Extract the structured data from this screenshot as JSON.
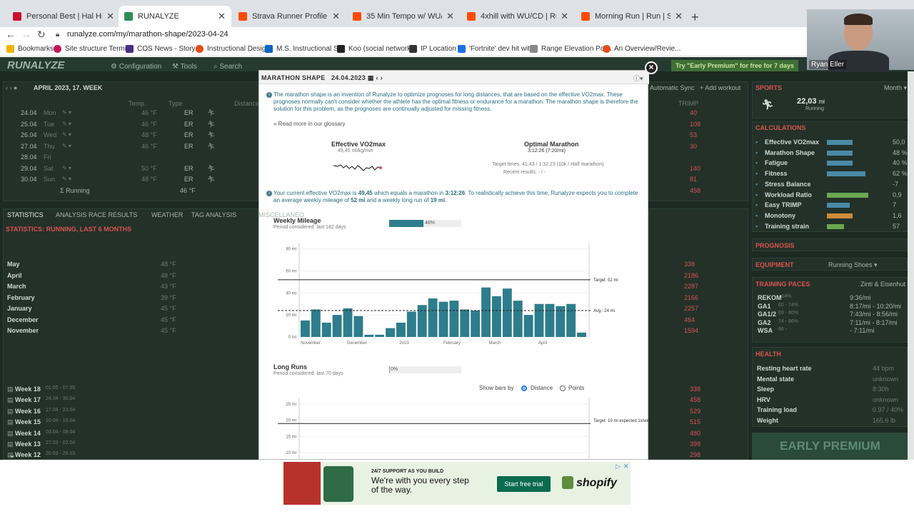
{
  "tabs": [
    {
      "title": "Personal Best | Hal Higdon",
      "color": "#c8102e"
    },
    {
      "title": "RUNALYZE",
      "color": "#2e8b57"
    },
    {
      "title": "Strava Runner Profile | Ryan Eller",
      "color": "#fc4c02"
    },
    {
      "title": "35 Min Tempo w/ WU/CD | Run |",
      "color": "#fc4c02"
    },
    {
      "title": "4xhill with WU/CD | Run | Strava",
      "color": "#fc4c02"
    },
    {
      "title": "Morning Run | Run | Strava",
      "color": "#fc4c02"
    }
  ],
  "url": "runalyze.com/my/marathon-shape/2023-04-24",
  "bookmarks": [
    {
      "label": "Bookmarks",
      "color": "#f2b400"
    },
    {
      "label": "Site structure Termi...",
      "color": "#c2185b"
    },
    {
      "label": "COS News - Story/...",
      "color": "#4b2e83"
    },
    {
      "label": "Instructional Design",
      "color": "#e64a19"
    },
    {
      "label": "M.S. Instructional S...",
      "color": "#0a66c2"
    },
    {
      "label": "Koo (social network...",
      "color": "#222222"
    },
    {
      "label": "IP Location",
      "color": "#333333"
    },
    {
      "label": "'Fortnite' dev hit wit...",
      "color": "#1a73e8"
    },
    {
      "label": "Range Elevation Pol...",
      "color": "#888888"
    },
    {
      "label": "An Overview/Revie...",
      "color": "#e64a19"
    }
  ],
  "webcam_name": "Ryan Eller",
  "app": {
    "logo": "RUNALYZE",
    "nav": [
      "Configuration",
      "Tools",
      "Search"
    ],
    "premium": "Try \"Early Premium\" for free for 7 days",
    "week_title": "APRIL 2023, 17. WEEK",
    "days": [
      {
        "date": "24.04",
        "day": "Mon",
        "temp": "46 °F",
        "type": "ER"
      },
      {
        "date": "25.04",
        "day": "Tue",
        "temp": "46 °F",
        "type": "ER"
      },
      {
        "date": "26.04",
        "day": "Wed",
        "temp": "48 °F",
        "type": "ER"
      },
      {
        "date": "27.04",
        "day": "Thu",
        "temp": "46 °F",
        "type": "ER"
      },
      {
        "date": "28.04",
        "day": "Fri",
        "temp": "",
        "type": ""
      },
      {
        "date": "29.04",
        "day": "Sat",
        "temp": "50 °F",
        "type": "ER"
      },
      {
        "date": "30.04",
        "day": "Sun",
        "temp": "48 °F",
        "type": "ER"
      }
    ],
    "trimp": [
      "40",
      "108",
      "53",
      "30",
      "",
      "140",
      "81"
    ],
    "sum_label": "Running",
    "sum_temp": "46 °F",
    "sum_trimp": "458",
    "stats_tabs": [
      "STATISTICS",
      "ANALYSIS",
      "RACE RESULTS",
      "WEATHER",
      "TAG ANALYSIS",
      "MISCELLANEO"
    ],
    "stats_title": "STATISTICS: RUNNING, LAST 6 MONTHS",
    "months": [
      {
        "name": "May",
        "temp": "48 °F",
        "trimp": "338"
      },
      {
        "name": "April",
        "temp": "48 °F",
        "trimp": "2186"
      },
      {
        "name": "March",
        "temp": "43 °F",
        "trimp": "2287"
      },
      {
        "name": "February",
        "temp": "39 °F",
        "trimp": "2166"
      },
      {
        "name": "January",
        "temp": "45 °F",
        "trimp": "2257"
      },
      {
        "name": "December",
        "temp": "45 °F",
        "trimp": "464"
      },
      {
        "name": "November",
        "temp": "45 °F",
        "trimp": "1594"
      }
    ],
    "weeks": [
      {
        "name": "Week 18",
        "range": "01.05 - 07.05",
        "trimp": "338"
      },
      {
        "name": "Week 17",
        "range": "24.04 - 30.04",
        "trimp": "458"
      },
      {
        "name": "Week 16",
        "range": "17.04 - 23.04",
        "trimp": "529"
      },
      {
        "name": "Week 15",
        "range": "10.04 - 16.04",
        "trimp": "515"
      },
      {
        "name": "Week 14",
        "range": "03.04 - 09.04",
        "trimp": "480"
      },
      {
        "name": "Week 13",
        "range": "27.03 - 02.04",
        "trimp": "398"
      },
      {
        "name": "Week 12",
        "range": "20.03 - 26.03",
        "trimp": "298"
      }
    ],
    "right_ctrl": [
      "Automatic Sync",
      "Add workout",
      "Month"
    ],
    "sports_title": "SPORTS",
    "sports_value": "22,03",
    "sports_unit": "mi",
    "sports_label": "Running",
    "calc_title": "CALCULATIONS",
    "calcs": [
      {
        "label": "Effective VO2max",
        "value": "50,0",
        "bar": 0.45,
        "color": "#4a8aa8"
      },
      {
        "label": "Marathon Shape",
        "value": "48 %",
        "bar": 0.45,
        "color": "#4a8aa8"
      },
      {
        "label": "Fatigue",
        "value": "40 %",
        "bar": 0.45,
        "color": "#4a8aa8"
      },
      {
        "label": "Fitness",
        "value": "62 %",
        "bar": 0.68,
        "color": "#4a8aa8"
      },
      {
        "label": "Stress Balance",
        "value": "-7",
        "bar": 0.0,
        "color": "#4a8aa8"
      },
      {
        "label": "Workload Ratio",
        "value": "0,9",
        "bar": 0.72,
        "color": "#6aa84f"
      },
      {
        "label": "Easy TRIMP",
        "value": "7",
        "bar": 0.4,
        "color": "#4a8aa8"
      },
      {
        "label": "Monotony",
        "value": "1,6",
        "bar": 0.45,
        "color": "#d08a3a"
      },
      {
        "label": "Training strain",
        "value": "57",
        "bar": 0.3,
        "color": "#6aa84f"
      }
    ],
    "prognosis_title": "PROGNOSIS",
    "equipment_title": "EQUIPMENT",
    "equipment_sel": "Running Shoes",
    "paces_title": "TRAINING PACES",
    "paces_sel": "Zinti & Eisenhut",
    "paces": [
      {
        "label": "REKOM",
        "range": "- 64%",
        "value": "9:36/mi"
      },
      {
        "label": "GA1",
        "range": "60 - 74%",
        "value": "8:17/mi - 10:20/mi"
      },
      {
        "label": "GA1/2",
        "range": "69 - 80%",
        "value": "7:43/mi - 8:56/mi"
      },
      {
        "label": "GA2",
        "range": "74 - 86%",
        "value": "7:11/mi - 8:17/mi"
      },
      {
        "label": "WSA",
        "range": "86 -",
        "value": "- 7:11/mi"
      }
    ],
    "health_title": "HEALTH",
    "health": [
      {
        "label": "Resting heart rate",
        "value": "44 bpm"
      },
      {
        "label": "Mental state",
        "value": "unknown"
      },
      {
        "label": "Sleep",
        "value": "8:30h"
      },
      {
        "label": "HRV",
        "value": "unknown"
      },
      {
        "label": "Training load",
        "value": "0.97 / 40%"
      },
      {
        "label": "Weight",
        "value": "165.6 lb"
      }
    ],
    "early_premium": "EARLY PREMIUM"
  },
  "modal": {
    "title": "MARATHON SHAPE",
    "date": "24.04.2023",
    "intro": "The marathon shape is an invention of Runalyze to optimize prognoses for long distances, that are based on the effective VO2max. These prognoses normally can't consider whether the athlete has the optimal fitness or endurance for a marathon. The marathon shape is therefore the solution for this problem, as the prognoses are continually adjusted for missing fitness.",
    "glossary": "» Read more in our glossary",
    "vo2max_title": "Effective VO2max",
    "vo2max_value": "49,45 ml/kg/min",
    "optimal_title": "Optimal Marathon",
    "optimal_value": "3:12:26",
    "optimal_pace": "(7:20/mi)",
    "target_times": "Target times: 41:43 / 1:32:23 (10k / Half marathon)",
    "recent_results": "Recent results: - / -",
    "summary_pre": "Your current effective VO2max is ",
    "summary_vo2": "49,45",
    "summary_mid1": " which equals a marathon in ",
    "summary_time": "3:12:26",
    "summary_mid2": ". To realistically achieve this time, Runalyze expects you to complete an average weekly mileage of ",
    "summary_weekly": "52 mi",
    "summary_mid3": " and a weekly long run of ",
    "summary_long": "19 mi",
    "summary_end": ".",
    "weekly_title": "Weekly Mileage",
    "weekly_period": "Period considered: last 182 days",
    "weekly_pct": "48%",
    "longruns_title": "Long Runs",
    "longruns_period": "Period considered: last 70 days",
    "longruns_pct": "0%",
    "show_bars_by": "Show bars by",
    "opt_distance": "Distance",
    "opt_points": "Points"
  },
  "chart_data": [
    {
      "type": "bar",
      "title": "Weekly Mileage",
      "ylabel": "",
      "ylim": [
        0,
        85
      ],
      "yticks": [
        "0 mi",
        "20 mi",
        "40 mi",
        "60 mi",
        "80 mi"
      ],
      "xlabels": [
        "November",
        "December",
        "2023",
        "February",
        "March",
        "April"
      ],
      "values": [
        15,
        25,
        13,
        20,
        26,
        19,
        2,
        2,
        8,
        13,
        23,
        29,
        35,
        32,
        33,
        25,
        24,
        45,
        37,
        44,
        33,
        20,
        30,
        30,
        28,
        30,
        4
      ],
      "target": 52,
      "target_label": "Target: 52 mi",
      "avg": 24,
      "avg_label": "Avg.: 24 mi",
      "color": "#2e7d8c"
    },
    {
      "type": "bar",
      "title": "Long Runs",
      "ylim": [
        0,
        27
      ],
      "yticks": [
        "10 mi",
        "15 mi",
        "20 mi",
        "25 mi"
      ],
      "target": 19,
      "target_label": "Target: 19 mi expected 1x/week"
    }
  ],
  "ad": {
    "kicker": "24/7 SUPPORT AS YOU BUILD",
    "headline": "We're with you every step of the way.",
    "cta": "Start free trial",
    "brand": "shopify"
  }
}
